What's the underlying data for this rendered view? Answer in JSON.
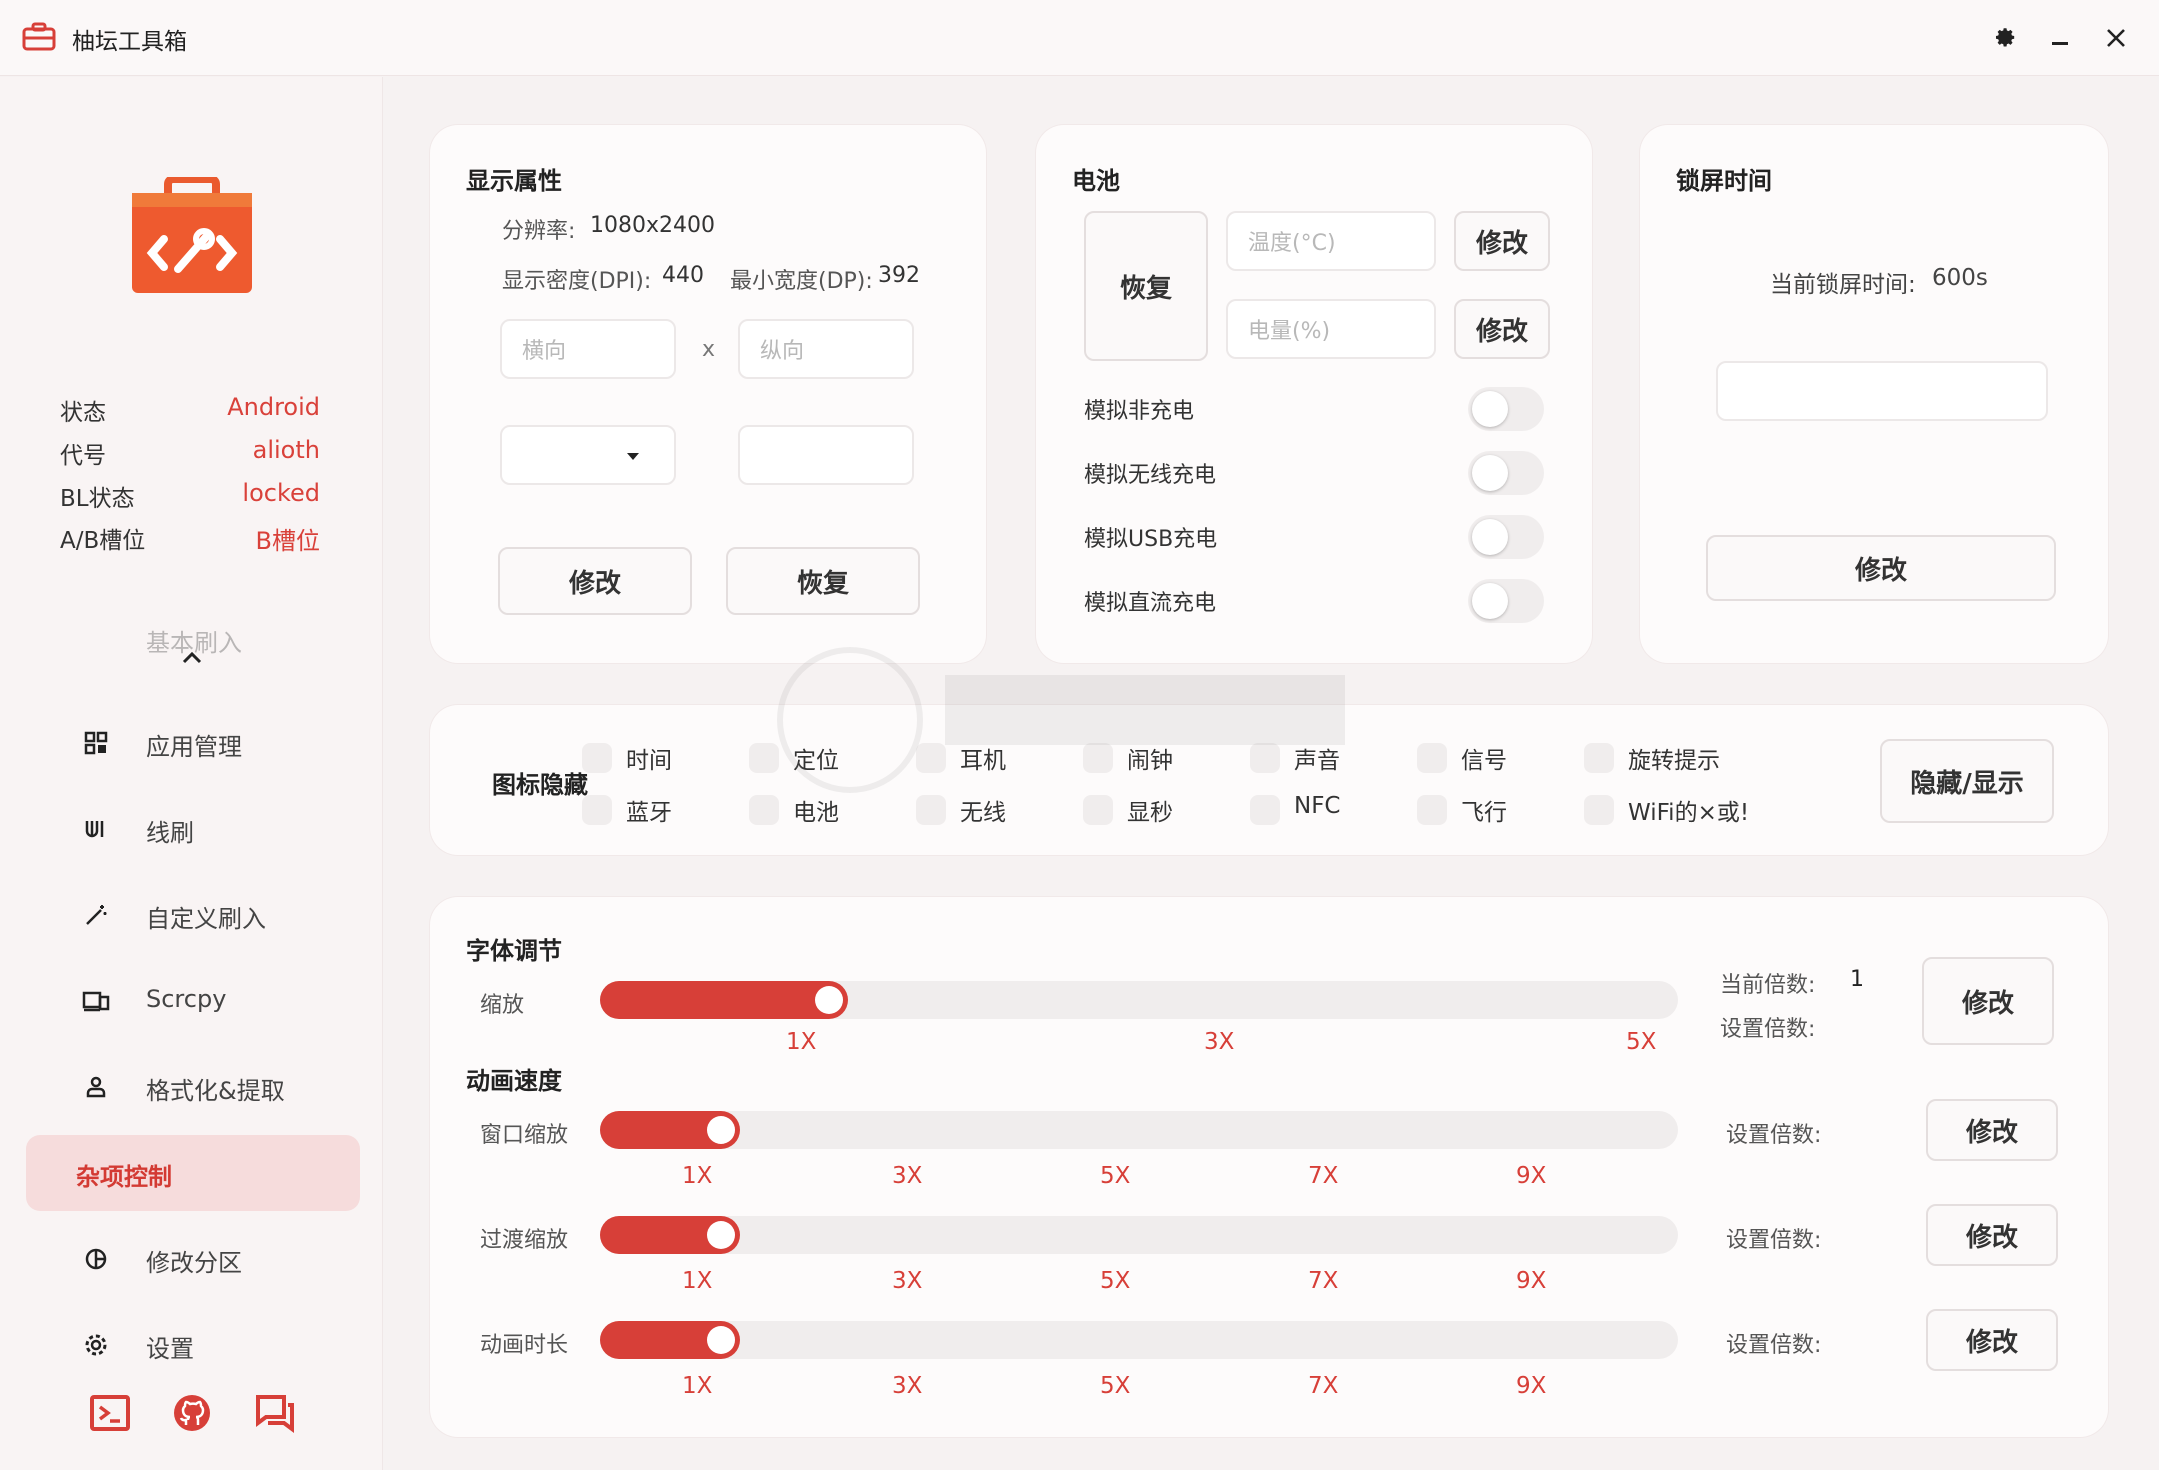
{
  "app": {
    "title": "柚坛工具箱"
  },
  "device_info": [
    {
      "key": "状态",
      "value": "Android"
    },
    {
      "key": "代号",
      "value": "alioth"
    },
    {
      "key": "BL状态",
      "value": "locked"
    },
    {
      "key": "A/B槽位",
      "value": "B槽位"
    }
  ],
  "nav": {
    "faded_item": "基本刷入",
    "items": [
      {
        "label": "应用管理",
        "icon": "grid-icon"
      },
      {
        "label": "线刷",
        "icon": "cable-icon"
      },
      {
        "label": "自定义刷入",
        "icon": "wand-icon"
      },
      {
        "label": "Scrcpy",
        "icon": "screen-icon"
      },
      {
        "label": "格式化&提取",
        "icon": "user-icon"
      },
      {
        "label": "杂项控制",
        "icon": "",
        "active": true
      },
      {
        "label": "修改分区",
        "icon": "partition-icon"
      },
      {
        "label": "设置",
        "icon": "gear-icon"
      }
    ]
  },
  "display": {
    "title": "显示属性",
    "resolution_label": "分辨率:",
    "resolution_value": "1080x2400",
    "dpi_label": "显示密度(DPI):",
    "dpi_value": "440",
    "min_width_label": "最小宽度(DP):",
    "min_width_value": "392",
    "landscape_placeholder": "横向",
    "times": "x",
    "portrait_placeholder": "纵向",
    "modify": "修改",
    "restore": "恢复"
  },
  "battery": {
    "title": "电池",
    "restore": "恢复",
    "temp_placeholder": "温度(°C)",
    "level_placeholder": "电量(%)",
    "modify": "修改",
    "toggles": [
      {
        "label": "模拟非充电",
        "on": false
      },
      {
        "label": "模拟无线充电",
        "on": false
      },
      {
        "label": "模拟USB充电",
        "on": false
      },
      {
        "label": "模拟直流充电",
        "on": false
      }
    ]
  },
  "lock": {
    "title": "锁屏时间",
    "current_label": "当前锁屏时间:",
    "current_value": "600s",
    "modify": "修改"
  },
  "icon_hide": {
    "title": "图标隐藏",
    "row1": [
      "时间",
      "定位",
      "耳机",
      "闹钟",
      "声音",
      "信号",
      "旋转提示"
    ],
    "row2": [
      "蓝牙",
      "电池",
      "无线",
      "显秒",
      "NFC",
      "飞行",
      "WiFi的×或!"
    ],
    "button": "隐藏/显示"
  },
  "font": {
    "title": "字体调节",
    "scale_label": "缩放",
    "ticks": [
      "1X",
      "3X",
      "5X"
    ],
    "current_label": "当前倍数:",
    "current_value": "1",
    "set_label": "设置倍数:",
    "modify": "修改",
    "fill_fraction": 0.23
  },
  "anim": {
    "title": "动画速度",
    "ticks": [
      "1X",
      "3X",
      "5X",
      "7X",
      "9X"
    ],
    "set_label": "设置倍数:",
    "modify": "修改",
    "rows": [
      {
        "label": "窗口缩放",
        "fill_fraction": 0.13
      },
      {
        "label": "过渡缩放",
        "fill_fraction": 0.13
      },
      {
        "label": "动画时长",
        "fill_fraction": 0.13
      }
    ]
  },
  "colors": {
    "accent": "#d73f38",
    "active_bg": "#f6dcdc"
  }
}
